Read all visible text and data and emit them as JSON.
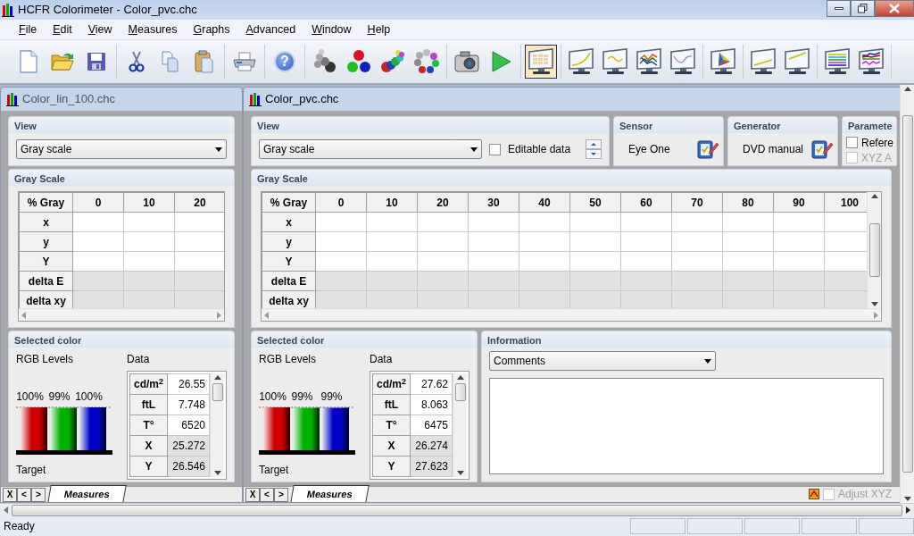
{
  "window": {
    "title": "HCFR Colorimeter - Color_pvc.chc"
  },
  "menu": [
    {
      "label": "File"
    },
    {
      "label": "Edit"
    },
    {
      "label": "View"
    },
    {
      "label": "Measures"
    },
    {
      "label": "Graphs"
    },
    {
      "label": "Advanced"
    },
    {
      "label": "Window"
    },
    {
      "label": "Help"
    }
  ],
  "toolbar_groups": [
    {
      "buttons": [
        {
          "kind": "new",
          "selected": false
        },
        {
          "kind": "open",
          "selected": false
        },
        {
          "kind": "save",
          "selected": false
        }
      ]
    },
    {
      "buttons": [
        {
          "kind": "cut",
          "selected": false
        },
        {
          "kind": "copy",
          "selected": false
        },
        {
          "kind": "paste",
          "selected": false
        }
      ]
    },
    {
      "buttons": [
        {
          "kind": "print",
          "selected": false
        }
      ]
    },
    {
      "buttons": [
        {
          "kind": "help",
          "label": "?",
          "selected": false
        }
      ]
    },
    {
      "buttons": [
        {
          "kind": "molecule",
          "selected": false
        },
        {
          "kind": "rgb",
          "selected": false
        },
        {
          "kind": "colors",
          "selected": false
        },
        {
          "kind": "ring",
          "selected": false
        }
      ]
    },
    {
      "buttons": [
        {
          "kind": "camera",
          "selected": false
        },
        {
          "kind": "play",
          "selected": false
        }
      ]
    },
    {
      "buttons": [
        {
          "kind": "table",
          "selected": true
        }
      ]
    },
    {
      "buttons": [
        {
          "kind": "curve",
          "selected": false
        },
        {
          "kind": "wave",
          "selected": false
        },
        {
          "kind": "multi",
          "selected": false
        },
        {
          "kind": "line",
          "selected": false
        }
      ]
    },
    {
      "buttons": [
        {
          "kind": "gamut",
          "selected": false
        }
      ]
    },
    {
      "buttons": [
        {
          "kind": "rise",
          "selected": false
        },
        {
          "kind": "rise2",
          "selected": false
        }
      ]
    },
    {
      "buttons": [
        {
          "kind": "bars",
          "selected": false
        },
        {
          "kind": "lines",
          "selected": false
        }
      ]
    }
  ],
  "documents": [
    {
      "title": "Color_lin_100.chc",
      "view": {
        "title": "View",
        "mode": "Gray scale"
      },
      "gray_scale": {
        "title": "Gray Scale",
        "columns": [
          "% Gray",
          "0",
          "10",
          "20"
        ],
        "rows": [
          {
            "label": "x",
            "shaded": false
          },
          {
            "label": "y",
            "shaded": false
          },
          {
            "label": "Y",
            "shaded": false
          },
          {
            "label": "delta E",
            "shaded": true
          },
          {
            "label": "delta xy",
            "shaded": true
          }
        ]
      },
      "selected_color": {
        "title": "Selected color",
        "levels_label": "RGB Levels",
        "data_label": "Data",
        "target_label": "Target",
        "bars": [
          {
            "value": "100%",
            "level": 1,
            "color": "#d00000"
          },
          {
            "value": "99%",
            "level": 0.99,
            "color": "#00b000"
          },
          {
            "value": "100%",
            "level": 1,
            "color": "#0000c8"
          }
        ],
        "data": [
          {
            "label": "cd/m$^{2}$",
            "value": "26.55",
            "shaded": false
          },
          {
            "label": "ftL",
            "value": "7.748",
            "shaded": false
          },
          {
            "label": "T°",
            "value": "6520",
            "shaded": false
          },
          {
            "label": "X",
            "value": "25.272",
            "shaded": true
          },
          {
            "label": "Y",
            "value": "26.546",
            "shaded": true
          }
        ]
      },
      "tab_nav": [
        "X",
        "<",
        ">"
      ],
      "tabs": [
        {
          "label": "Measures",
          "selected": true
        }
      ]
    },
    {
      "title": "Color_pvc.chc",
      "view": {
        "title": "View",
        "mode": "Gray scale",
        "editable": {
          "label": "Editable data",
          "checked": false
        }
      },
      "sensor": {
        "title": "Sensor",
        "name": "Eye One"
      },
      "generator": {
        "title": "Generator",
        "name": "DVD manual"
      },
      "parameters": {
        "title": "Paramete",
        "options": [
          {
            "label": "Refere",
            "checked": false,
            "disabled": false
          },
          {
            "label": "XYZ A",
            "checked": false,
            "disabled": true
          }
        ]
      },
      "gray_scale": {
        "title": "Gray Scale",
        "columns": [
          "% Gray",
          "0",
          "10",
          "20",
          "30",
          "40",
          "50",
          "60",
          "70",
          "80",
          "90",
          "100"
        ],
        "rows": [
          {
            "label": "x",
            "shaded": false
          },
          {
            "label": "y",
            "shaded": false
          },
          {
            "label": "Y",
            "shaded": false
          },
          {
            "label": "delta E",
            "shaded": true
          },
          {
            "label": "delta xy",
            "shaded": true
          }
        ]
      },
      "selected_color": {
        "title": "Selected color",
        "levels_label": "RGB Levels",
        "data_label": "Data",
        "target_label": "Target",
        "bars": [
          {
            "value": "100%",
            "level": 1,
            "color": "#d00000"
          },
          {
            "value": "99%",
            "level": 0.99,
            "color": "#00b000"
          },
          {
            "value": "99%",
            "level": 0.99,
            "color": "#0000c8"
          }
        ],
        "data": [
          {
            "label": "cd/m$^{2}$",
            "value": "27.62",
            "shaded": false
          },
          {
            "label": "ftL",
            "value": "8.063",
            "shaded": false
          },
          {
            "label": "T°",
            "value": "6475",
            "shaded": false
          },
          {
            "label": "X",
            "value": "26.274",
            "shaded": true
          },
          {
            "label": "Y",
            "value": "27.623",
            "shaded": true
          }
        ]
      },
      "information": {
        "title": "Information",
        "mode": "Comments"
      },
      "tab_nav": [
        "X",
        "<",
        ">"
      ],
      "tabs": [
        {
          "label": "Measures",
          "selected": true
        }
      ],
      "adjust": {
        "label": "Adjust XYZ",
        "checked": false,
        "disabled": true
      }
    }
  ],
  "status_bar": {
    "text": "Ready"
  }
}
